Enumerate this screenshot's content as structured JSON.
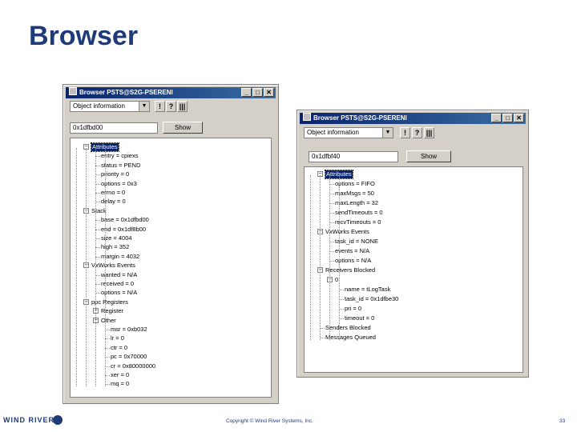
{
  "slide": {
    "title": "Browser"
  },
  "window1": {
    "title": "Browser PSTS@S2G-PSERENI",
    "min": "_",
    "max": "□",
    "close": "✕",
    "combo_value": "Object information",
    "toolbar": [
      "!",
      "?",
      "|||"
    ],
    "address": "0x1dfbd00",
    "show_label": "Show",
    "tree": [
      {
        "text": "Attributes",
        "sel": true
      },
      {
        "text": "entry  = cpiexs"
      },
      {
        "text": "status = PEND"
      },
      {
        "text": "priority = 0"
      },
      {
        "text": "options = 0x3"
      },
      {
        "text": "errno = 0"
      },
      {
        "text": "delay = 0"
      },
      {
        "text": "Stack"
      },
      {
        "text": "base = 0x1dfbd00"
      },
      {
        "text": "end = 0x1df8b00"
      },
      {
        "text": "size = 4004"
      },
      {
        "text": "high = 352"
      },
      {
        "text": "margin = 4032"
      },
      {
        "text": "VxWorks Events"
      },
      {
        "text": "wanted = N/A"
      },
      {
        "text": "received = 0"
      },
      {
        "text": "options = N/A"
      },
      {
        "text": "ppc Registers"
      },
      {
        "text": "Register"
      },
      {
        "text": "Other"
      },
      {
        "text": "msr = 0xb032"
      },
      {
        "text": "lr = 0"
      },
      {
        "text": "ctr = 0"
      },
      {
        "text": "pc = 0x70000"
      },
      {
        "text": "cr = 0x80000000"
      },
      {
        "text": "xer = 0"
      },
      {
        "text": "mq = 0"
      }
    ]
  },
  "window2": {
    "title": "Browser PSTS@S2G-PSERENI",
    "min": "_",
    "max": "□",
    "close": "✕",
    "combo_value": "Object information",
    "toolbar": [
      "!",
      "?",
      "|||"
    ],
    "address": "0x1dfbf40",
    "show_label": "Show",
    "tree": [
      {
        "text": "Attributes",
        "sel": true
      },
      {
        "text": "options = FIFO"
      },
      {
        "text": "maxMsgs = 50"
      },
      {
        "text": "maxLength = 32"
      },
      {
        "text": "sendTimeouts = 0"
      },
      {
        "text": "recvTimeouts = 0"
      },
      {
        "text": "VxWorks Events"
      },
      {
        "text": "task_id = NONE"
      },
      {
        "text": "events = N/A"
      },
      {
        "text": "options = N/A"
      },
      {
        "text": "Receivers Blocked"
      },
      {
        "text": "0"
      },
      {
        "text": "name = tLogTask"
      },
      {
        "text": "task_id = 0x1dfbe30"
      },
      {
        "text": "pri = 0"
      },
      {
        "text": "timeout = 0"
      },
      {
        "text": "Senders Blocked"
      },
      {
        "text": "Messages Queued"
      }
    ]
  },
  "footer": {
    "logo": "WIND RIVER",
    "copyright": "Copyright © Wind River Systems, Inc.",
    "page": "33"
  }
}
